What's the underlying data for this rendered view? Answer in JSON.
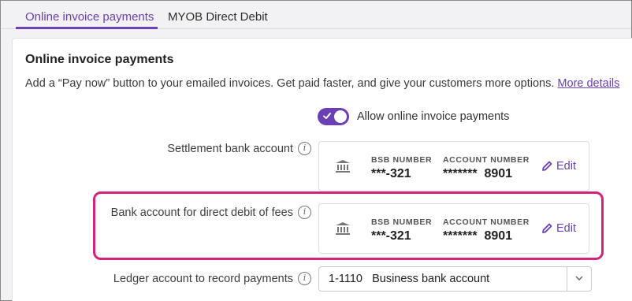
{
  "tabs": [
    {
      "label": "Online invoice payments",
      "active": true
    },
    {
      "label": "MYOB Direct Debit",
      "active": false
    }
  ],
  "section": {
    "title": "Online invoice payments",
    "description": "Add a “Pay now” button to your emailed invoices. Get paid faster, and give your customers more options.",
    "more_link": "More details"
  },
  "toggle": {
    "label": "Allow online invoice payments",
    "on": true
  },
  "settlement": {
    "label": "Settlement bank account",
    "bsb_heading": "BSB NUMBER",
    "bsb_value": "***-321",
    "account_heading": "ACCOUNT NUMBER",
    "account_value": "*******  8901",
    "edit_label": "Edit"
  },
  "direct_debit": {
    "label": "Bank account for direct debit of fees",
    "bsb_heading": "BSB NUMBER",
    "bsb_value": "***-321",
    "account_heading": "ACCOUNT NUMBER",
    "account_value": "*******  8901",
    "edit_label": "Edit"
  },
  "ledger": {
    "label": "Ledger account to record payments",
    "selected": "1-1110   Business bank account"
  },
  "colors": {
    "accent": "#6b3fb5",
    "highlight": "#d4237a"
  },
  "icons": [
    "bank-icon",
    "info-icon",
    "pencil-icon",
    "check-icon",
    "chevron-down-icon"
  ]
}
